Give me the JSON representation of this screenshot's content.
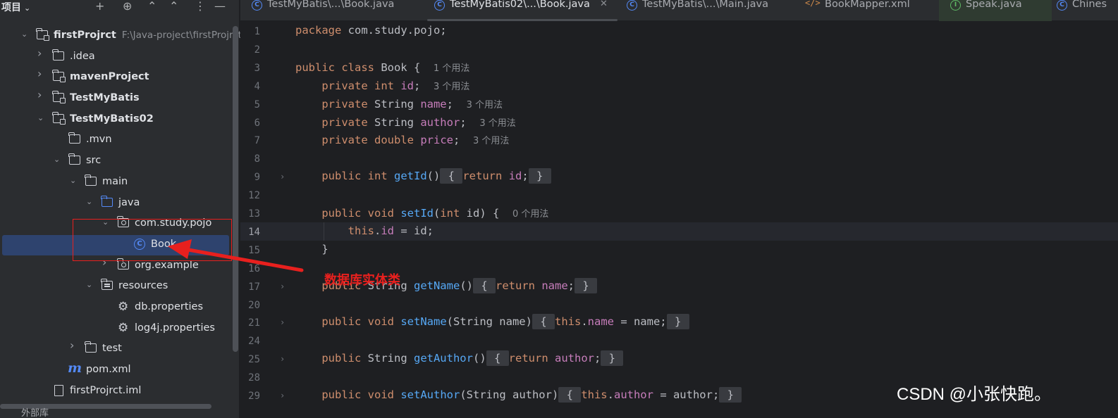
{
  "project_panel": {
    "title": "项目",
    "tree": [
      {
        "label": "firstProjrct",
        "path": "F:\\Java-project\\firstProjrct",
        "bold": true,
        "depth": 0,
        "icon": "module-folder",
        "expanded": true
      },
      {
        "label": ".idea",
        "depth": 1,
        "icon": "folder",
        "expanded": false
      },
      {
        "label": "mavenProject",
        "bold": true,
        "depth": 1,
        "icon": "module-folder",
        "expanded": false
      },
      {
        "label": "TestMyBatis",
        "bold": true,
        "depth": 1,
        "icon": "module-folder",
        "expanded": false
      },
      {
        "label": "TestMyBatis02",
        "bold": true,
        "depth": 1,
        "icon": "module-folder",
        "expanded": true
      },
      {
        "label": ".mvn",
        "depth": 2,
        "icon": "folder"
      },
      {
        "label": "src",
        "depth": 2,
        "icon": "folder",
        "expanded": true
      },
      {
        "label": "main",
        "depth": 3,
        "icon": "folder",
        "expanded": true
      },
      {
        "label": "java",
        "depth": 4,
        "icon": "source-folder",
        "expanded": true
      },
      {
        "label": "com.study.pojo",
        "depth": 5,
        "icon": "package",
        "expanded": true
      },
      {
        "label": "Book",
        "depth": 6,
        "icon": "class",
        "selected": true
      },
      {
        "label": "org.example",
        "depth": 5,
        "icon": "package",
        "expanded": false
      },
      {
        "label": "resources",
        "depth": 4,
        "icon": "resources-folder",
        "expanded": true
      },
      {
        "label": "db.properties",
        "depth": 5,
        "icon": "properties-gear"
      },
      {
        "label": "log4j.properties",
        "depth": 5,
        "icon": "properties-gear"
      },
      {
        "label": "test",
        "depth": 3,
        "icon": "folder",
        "expanded": false
      },
      {
        "label": "pom.xml",
        "depth": 2,
        "icon": "maven"
      },
      {
        "label": "firstProjrct.iml",
        "depth": 1,
        "icon": "iml-file"
      }
    ],
    "bottom_label": "外部库"
  },
  "tabs": [
    {
      "label": "TestMyBatis\\...\\Book.java",
      "icon": "class"
    },
    {
      "label": "TestMyBatis02\\...\\Book.java",
      "icon": "class",
      "active": true
    },
    {
      "label": "TestMyBatis\\...\\Main.java",
      "icon": "class"
    },
    {
      "label": "BookMapper.xml",
      "icon": "xml"
    },
    {
      "label": "Speak.java",
      "icon": "interface"
    },
    {
      "label": "Chines",
      "icon": "class"
    }
  ],
  "editor": {
    "current_line": 14,
    "lines": [
      {
        "n": "1",
        "html": "<span class='kw'>package</span> com.study.pojo;"
      },
      {
        "n": "2",
        "html": ""
      },
      {
        "n": "3",
        "html": "<span class='kw'>public class</span> Book {  <span class='hint'>1 个用法</span>"
      },
      {
        "n": "4",
        "html": "    <span class='kw'>private int</span> <span class='fld'>id</span>;  <span class='hint'>3 个用法</span>"
      },
      {
        "n": "5",
        "html": "    <span class='kw'>private</span> String <span class='fld'>name</span>;  <span class='hint'>3 个用法</span>"
      },
      {
        "n": "6",
        "html": "    <span class='kw'>private</span> String <span class='fld'>author</span>;  <span class='hint'>3 个用法</span>"
      },
      {
        "n": "7",
        "html": "    <span class='kw'>private double</span> <span class='fld'>price</span>;  <span class='hint'>3 个用法</span>"
      },
      {
        "n": "8",
        "html": ""
      },
      {
        "n": "9",
        "fold": true,
        "html": "    <span class='kw'>public int</span> <span class='mth'>getId</span>()<span class='brc'> { </span><span class='kw'>return</span> <span class='fld'>id</span>;<span class='brc'> } </span>"
      },
      {
        "n": "12",
        "html": ""
      },
      {
        "n": "13",
        "html": "    <span class='kw'>public void</span> <span class='mth'>setId</span>(<span class='kw'>int</span> id) {  <span class='hint'>0 个用法</span>"
      },
      {
        "n": "14",
        "html": "        <span class='kw'>this</span>.<span class='fld'>id</span> = id;"
      },
      {
        "n": "15",
        "html": "    }"
      },
      {
        "n": "16",
        "html": ""
      },
      {
        "n": "17",
        "fold": true,
        "html": "    <span class='kw'>public</span> String <span class='mth'>getName</span>()<span class='brc'> { </span><span class='kw'>return</span> <span class='fld'>name</span>;<span class='brc'> } </span>"
      },
      {
        "n": "20",
        "html": ""
      },
      {
        "n": "21",
        "fold": true,
        "html": "    <span class='kw'>public void</span> <span class='mth'>setName</span>(String name)<span class='brc'> { </span><span class='kw'>this</span>.<span class='fld'>name</span> = name;<span class='brc'> } </span>"
      },
      {
        "n": "24",
        "html": ""
      },
      {
        "n": "25",
        "fold": true,
        "html": "    <span class='kw'>public</span> String <span class='mth'>getAuthor</span>()<span class='brc'> { </span><span class='kw'>return</span> <span class='fld'>author</span>;<span class='brc'> } </span>"
      },
      {
        "n": "28",
        "html": ""
      },
      {
        "n": "29",
        "fold": true,
        "html": "    <span class='kw'>public void</span> <span class='mth'>setAuthor</span>(String author)<span class='brc'> { </span><span class='kw'>this</span>.<span class='fld'>author</span> = author;<span class='brc'> } </span>"
      }
    ]
  },
  "annotation": {
    "text": "数据库实体类",
    "color": "#e8201e"
  },
  "watermark": "CSDN @小张快跑。"
}
